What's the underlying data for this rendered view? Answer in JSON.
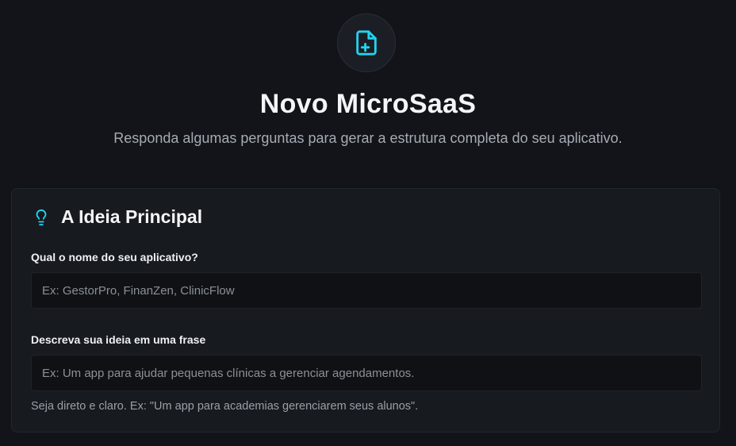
{
  "header": {
    "icon": "file-plus-icon",
    "title": "Novo MicroSaaS",
    "subtitle": "Responda algumas perguntas para gerar a estrutura completa do seu aplicativo."
  },
  "card": {
    "icon": "lightbulb-icon",
    "title": "A Ideia Principal",
    "fields": [
      {
        "label": "Qual o nome do seu aplicativo?",
        "value": "",
        "placeholder": "Ex: GestorPro, FinanZen, ClinicFlow"
      },
      {
        "label": "Descreva sua ideia em uma frase",
        "value": "",
        "placeholder": "Ex: Um app para ajudar pequenas clínicas a gerenciar agendamentos.",
        "hint": "Seja direto e claro. Ex: \"Um app para academias gerenciarem seus alunos\"."
      }
    ]
  },
  "colors": {
    "background": "#121419",
    "card": "#171a1f",
    "accent": "#22d3ee",
    "text": "#f4f5f7",
    "muted": "#a6abb3"
  }
}
